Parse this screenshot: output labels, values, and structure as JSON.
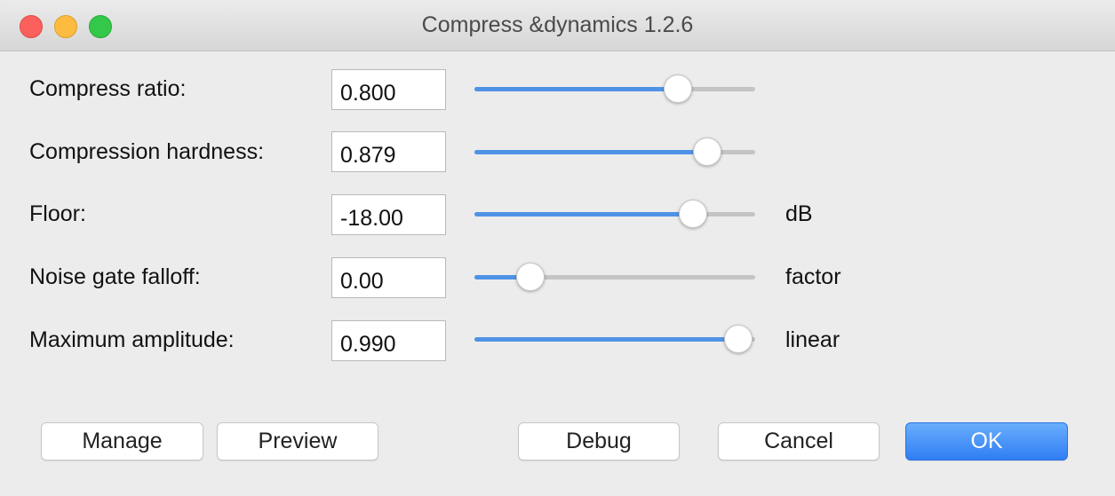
{
  "window": {
    "title": "Compress &dynamics 1.2.6"
  },
  "params": [
    {
      "label": "Compress ratio:",
      "value": "0.800",
      "unit": "",
      "slider_fraction": 0.725
    },
    {
      "label": "Compression hardness:",
      "value": "0.879",
      "unit": "",
      "slider_fraction": 0.83
    },
    {
      "label": "Floor:",
      "value": "-18.00",
      "unit": "dB",
      "slider_fraction": 0.78
    },
    {
      "label": "Noise gate falloff:",
      "value": "0.00",
      "unit": "factor",
      "slider_fraction": 0.2
    },
    {
      "label": "Maximum amplitude:",
      "value": "0.990",
      "unit": "linear",
      "slider_fraction": 0.94
    }
  ],
  "buttons": {
    "manage": "Manage",
    "preview": "Preview",
    "debug": "Debug",
    "cancel": "Cancel",
    "ok": "OK"
  },
  "colors": {
    "accent": "#4f93e6",
    "track": "#c4c4c4",
    "close": "#fc605c",
    "minimize": "#fdbc40",
    "maximize": "#34c84a"
  }
}
